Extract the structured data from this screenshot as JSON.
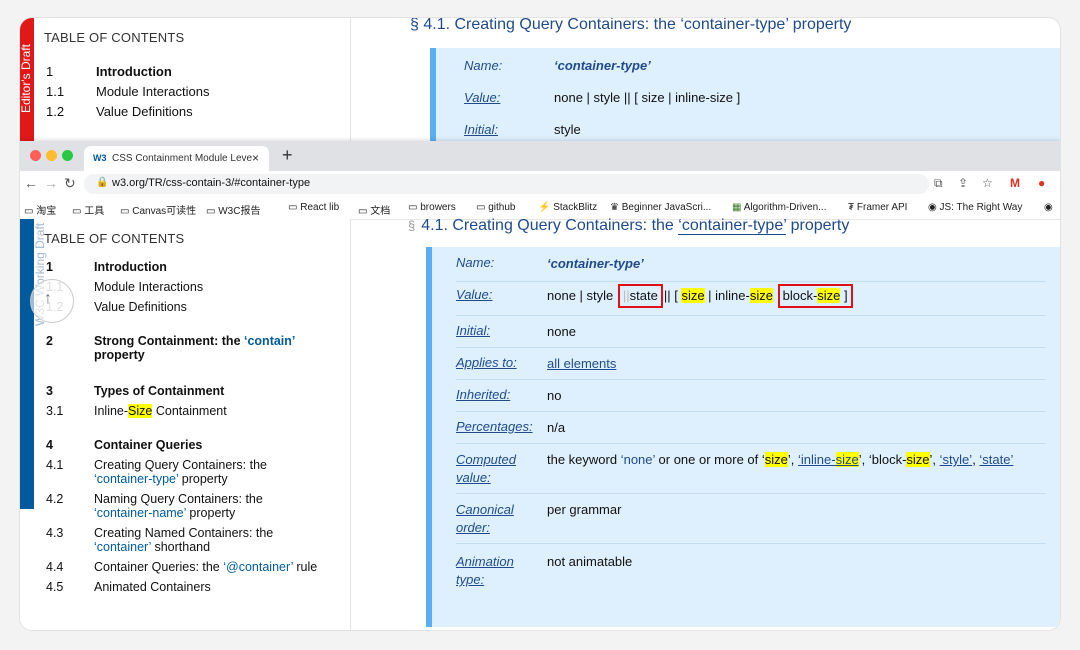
{
  "background_page": {
    "tag": "Editor's Draft",
    "toc_title": "TABLE OF CONTENTS",
    "toc": [
      {
        "num": "1",
        "label": "Introduction"
      },
      {
        "num": "1.1",
        "label": "Module Interactions"
      },
      {
        "num": "1.2",
        "label": "Value Definitions"
      }
    ],
    "heading": "§ 4.1. Creating Query Containers: the ‘container-type’ property",
    "def": [
      {
        "k": "Name:",
        "v": "‘container-type’"
      },
      {
        "k": "Value:",
        "v": "none | style || [ size | inline-size ]"
      },
      {
        "k": "Initial:",
        "v": "style"
      }
    ]
  },
  "browser": {
    "tab": {
      "favicon": "W3",
      "title": "CSS Containment Module Leve",
      "close": "×"
    },
    "new_tab": "+",
    "url": "w3.org/TR/css-contain-3/#container-type",
    "bookmarks": [
      "淘宝",
      "工具",
      "Canvas可读性",
      "W3C报告",
      "React lib",
      "文档",
      "browers",
      "github",
      "StackBlitz",
      "Beginner JavaScri...",
      "Algorithm-Driven...",
      "Framer API",
      "JS: The Right Way"
    ]
  },
  "page": {
    "tag": "W3C Working Draft",
    "toc_title": "TABLE OF CONTENTS",
    "toc": [
      {
        "num": "1",
        "label": "Introduction",
        "bold": true
      },
      {
        "num": "1.1",
        "label": "Module Interactions"
      },
      {
        "num": "1.2",
        "label": "Value Definitions"
      },
      {
        "num": "2",
        "label_a": "Strong Containment: the ",
        "code": "‘contain’",
        "label_b": "property",
        "bold": true
      },
      {
        "num": "3",
        "label": "Types of Containment",
        "bold": true
      },
      {
        "num": "3.1",
        "label_a": "Inline-",
        "hl": "Size",
        "label_b": " Containment"
      },
      {
        "num": "4",
        "label": "Container Queries",
        "bold": true
      },
      {
        "num": "4.1",
        "label_a": "Creating Query Containers: the ",
        "code": "‘container-type’",
        "label_b": " property"
      },
      {
        "num": "4.2",
        "label_a": "Naming Query Containers: the ",
        "code": "‘container-name’",
        "label_b": " property"
      },
      {
        "num": "4.3",
        "label_a": "Creating Named Containers: the ",
        "code": "‘container’",
        "label_b": " shorthand"
      },
      {
        "num": "4.4",
        "label_a": "Container Queries: the ",
        "code": "‘@container’",
        "label_b": " rule"
      },
      {
        "num": "4.5",
        "label": "Animated Containers"
      }
    ],
    "heading": {
      "sect": "§",
      "prefix": "4.1. Creating Query Containers: the ",
      "code": "‘container-type’",
      "suffix": " property"
    },
    "definition": {
      "name": {
        "k": "Name:",
        "v": "‘container-type’"
      },
      "value": {
        "k": "Value:",
        "v1": "none | style ",
        "or1": "||",
        "state": "state",
        "or2": "||",
        "v2": " [ ",
        "size": "size",
        "v3": " | inline-",
        "size2": "size",
        "block": "block-",
        "size3": "size",
        "v4": " ]"
      },
      "initial": {
        "k": "Initial:",
        "v": "none"
      },
      "applies": {
        "k": "Applies to:",
        "v": "all elements"
      },
      "inherited": {
        "k": "Inherited:",
        "v": "no"
      },
      "percentages": {
        "k": "Percentages:",
        "v": "n/a"
      },
      "computed": {
        "k": "Computed value:",
        "v1": "the keyword ",
        "kw": "‘none’",
        "v2": " or one or more of ",
        "s1": "size",
        "c1": "’, ",
        "s2a": "‘inline-",
        "s2": "size",
        "c2": "’, ",
        "s3a": "‘block-",
        "s3": "size",
        "c3": "’, ",
        "s4": "‘style’",
        "c4": ", ",
        "s5": "‘state’"
      },
      "canonical": {
        "k": "Canonical order:",
        "v": "per grammar"
      },
      "animation": {
        "k": "Animation type:",
        "v": "not animatable"
      }
    }
  }
}
